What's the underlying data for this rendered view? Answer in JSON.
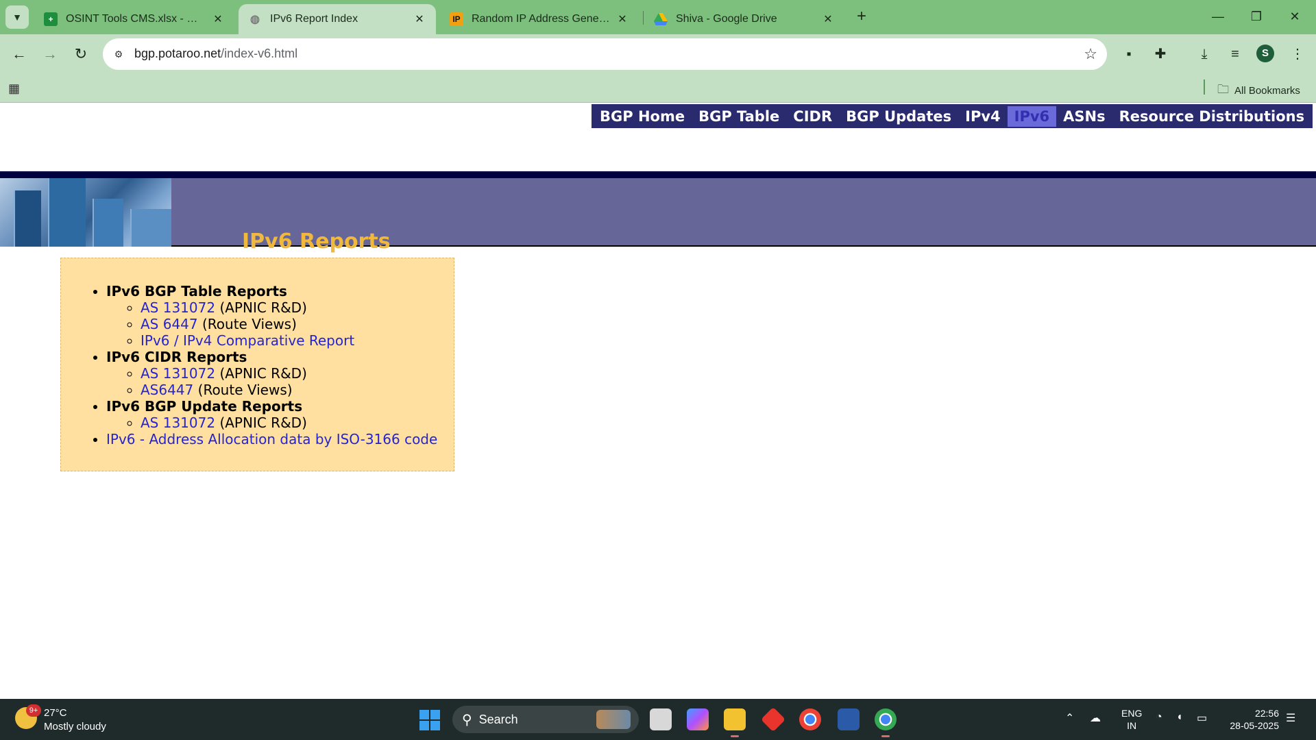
{
  "browser": {
    "tabs": [
      {
        "title": "OSINT Tools CMS.xlsx - Google",
        "favicon": "sheets-icon",
        "active": false
      },
      {
        "title": "IPv6 Report Index",
        "favicon": "globe-icon",
        "active": true
      },
      {
        "title": "Random IP Address Generator,",
        "favicon": "ip-icon",
        "active": false
      },
      {
        "title": "Shiva - Google Drive",
        "favicon": "drive-icon",
        "active": false
      }
    ],
    "url_host": "bgp.potaroo.net",
    "url_path": "/index-v6.html",
    "profile_initial": "S",
    "bookmarks_label": "All Bookmarks"
  },
  "site": {
    "nav": [
      {
        "label": "BGP Home",
        "current": false
      },
      {
        "label": "BGP Table",
        "current": false
      },
      {
        "label": "CIDR",
        "current": false
      },
      {
        "label": "BGP Updates",
        "current": false
      },
      {
        "label": "IPv4",
        "current": false
      },
      {
        "label": "IPv6",
        "current": true
      },
      {
        "label": "ASNs",
        "current": false
      },
      {
        "label": "Resource Distributions",
        "current": false
      }
    ],
    "page_title": "IPv6 Reports",
    "sections": [
      {
        "title": "IPv6 BGP Table Reports",
        "items": [
          {
            "link": "AS 131072",
            "note": " (APNIC R&D)"
          },
          {
            "link": "AS 6447",
            "note": " (Route Views)"
          },
          {
            "link": "IPv6 / IPv4 Comparative Report",
            "note": ""
          }
        ]
      },
      {
        "title": "IPv6 CIDR Reports",
        "items": [
          {
            "link": "AS 131072",
            "note": " (APNIC R&D)"
          },
          {
            "link": "AS6447",
            "note": " (Route Views)"
          }
        ]
      },
      {
        "title": "IPv6 BGP Update Reports",
        "items": [
          {
            "link": "AS 131072",
            "note": " (APNIC R&D)"
          }
        ]
      }
    ],
    "final_link": "IPv6 - Address Allocation data by ISO-3166 code"
  },
  "taskbar": {
    "weather_badge": "9+",
    "temperature": "27°C",
    "weather": "Mostly cloudy",
    "search_label": "Search",
    "lang_top": "ENG",
    "lang_bottom": "IN",
    "time": "22:56",
    "date": "28-05-2025"
  }
}
